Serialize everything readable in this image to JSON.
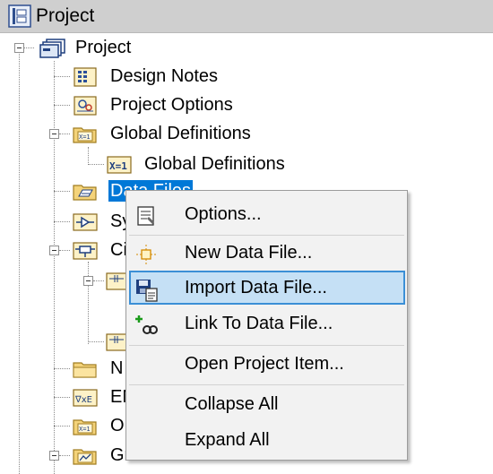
{
  "window": {
    "title": "Project",
    "icon": "project-panel-icon"
  },
  "tree": {
    "nodes": [
      {
        "label": "Project",
        "icon": "project-icon"
      },
      {
        "label": "Design Notes",
        "icon": "notes-icon"
      },
      {
        "label": "Project Options",
        "icon": "options-icon"
      },
      {
        "label": "Global Definitions",
        "icon": "global-defs-folder-icon"
      },
      {
        "label": "Global Definitions",
        "icon": "x-equals-one-icon"
      },
      {
        "label": "Data Files",
        "icon": "data-files-folder-icon",
        "selected": true
      },
      {
        "label": "Sy",
        "icon": "system-folder-icon"
      },
      {
        "label": "Ci",
        "icon": "circuit-folder-icon"
      },
      {
        "label": "N",
        "icon": "folder-icon"
      },
      {
        "label": "EN",
        "icon": "equation-folder-icon"
      },
      {
        "label": "O",
        "icon": "output-folder-icon"
      },
      {
        "label": "Gr",
        "icon": "graphs-folder-icon"
      }
    ]
  },
  "context_menu": {
    "items": [
      {
        "label": "Options...",
        "icon": "properties-icon"
      },
      {
        "label": "New Data File...",
        "icon": "new-data-file-icon"
      },
      {
        "label": "Import Data File...",
        "icon": "import-data-file-icon",
        "highlighted": true
      },
      {
        "label": "Link To Data File...",
        "icon": "link-data-file-icon"
      },
      {
        "label": "Open Project Item...",
        "icon": ""
      },
      {
        "label": "Collapse All",
        "icon": ""
      },
      {
        "label": "Expand All",
        "icon": ""
      }
    ]
  },
  "colors": {
    "selection": "#0078d7",
    "menu_highlight": "#c5e0f5",
    "menu_highlight_border": "#3b8fd6",
    "titlebar": "#cfcfcf"
  }
}
